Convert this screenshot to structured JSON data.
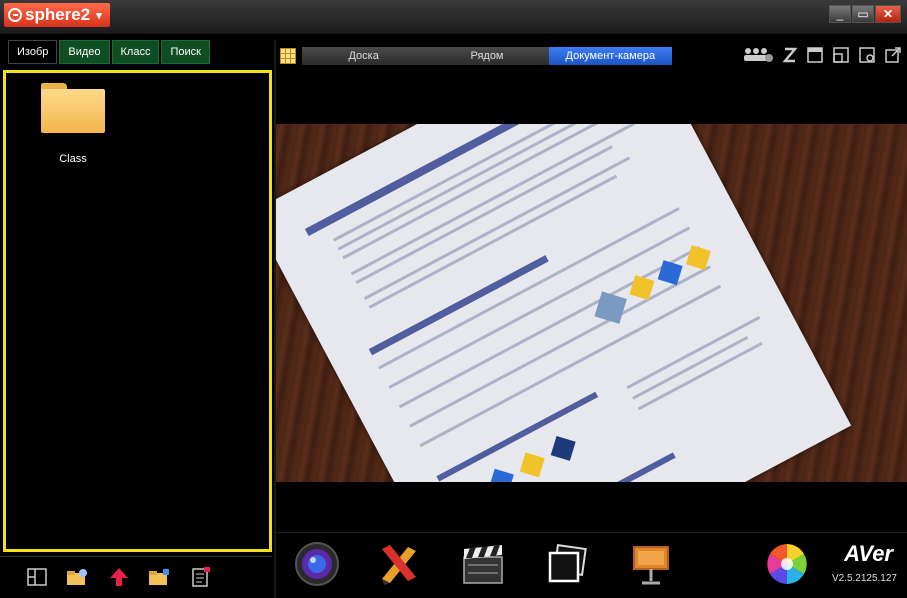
{
  "app": {
    "name": "sphere2",
    "menu_caret": "▾"
  },
  "window_controls": {
    "minimize": "_",
    "restore": "▭",
    "close": "✕"
  },
  "left_tabs": [
    {
      "label": "Изобр",
      "active": true
    },
    {
      "label": "Видео",
      "active": false
    },
    {
      "label": "Класс",
      "active": false
    },
    {
      "label": "Поиск",
      "active": false
    }
  ],
  "folders": [
    {
      "label": "Class"
    }
  ],
  "modes": [
    {
      "label": "Доска",
      "active": false
    },
    {
      "label": "Рядом",
      "active": false
    },
    {
      "label": "Документ-камера",
      "active": true
    }
  ],
  "toolbar_icons": [
    "users-icon",
    "sleep-icon",
    "window-icon",
    "split-icon",
    "capture-icon",
    "popout-icon"
  ],
  "bottom_left_icons": [
    "panel-toggle-icon",
    "new-folder-icon",
    "up-arrow-icon",
    "import-folder-icon",
    "properties-icon"
  ],
  "bottom_tools": [
    "camera-lens-icon",
    "annotation-pencil-icon",
    "clapperboard-icon",
    "snapshot-frames-icon",
    "projector-icon",
    "color-wheel-icon"
  ],
  "brand": {
    "logo": "AVer",
    "version": "V2.5.2125.127"
  },
  "colors": {
    "selection_border": "#f2e21c",
    "active_mode": "#2a63d6",
    "tab_green": "#0f4e22",
    "brand_red": "#e0452d"
  }
}
